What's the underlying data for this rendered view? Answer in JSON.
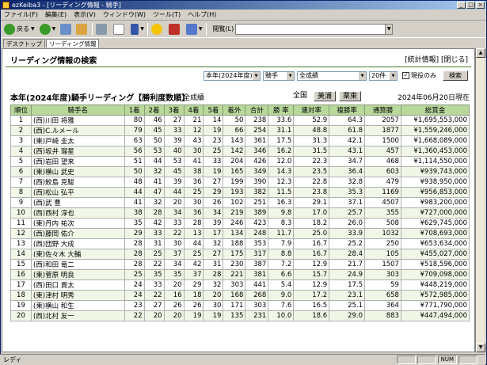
{
  "window": {
    "title": "ezKeiba3 - [リーディング情報 - 騎手]"
  },
  "menu": [
    "ファイル(F)",
    "編集(E)",
    "表示(V)",
    "ウィンドウ(W)",
    "ツール(T)",
    "ヘルプ(H)"
  ],
  "toolbar": {
    "back": "戻る",
    "address_label": "閲覧(L)",
    "address_value": ""
  },
  "tabs": [
    "デスクトップ",
    "リーディング情報"
  ],
  "page": {
    "title": "リーディング情報の検索",
    "links": "[統計情報] [閉じる]",
    "filters": {
      "year": "本年(2024年度)",
      "kind": "騎手",
      "scope": "全成績",
      "count": "20件",
      "checkbox_label": "現役のみ",
      "checked": true,
      "search_button": "検索"
    },
    "heading": "本年(2024年度)騎手リーディング【勝利度数順】",
    "scope_label": "全成績",
    "orgs": [
      "全国",
      "美浦",
      "栗東"
    ],
    "as_of": "2024年06月20日現在"
  },
  "table": {
    "headers": [
      "順位",
      "騎手名",
      "1着",
      "2着",
      "3着",
      "4着",
      "5着",
      "着外",
      "合計",
      "勝 率",
      "連対率",
      "複勝率",
      "通算勝",
      "総賞金"
    ],
    "rows": [
      [
        "1",
        "(西)川田 将雅",
        "80",
        "46",
        "27",
        "21",
        "14",
        "50",
        "238",
        "33.6",
        "52.9",
        "64.3",
        "2057",
        "¥1,695,553,000"
      ],
      [
        "2",
        "(西)C.ルメール",
        "79",
        "45",
        "33",
        "12",
        "19",
        "66",
        "254",
        "31.1",
        "48.8",
        "61.8",
        "1877",
        "¥1,559,246,000"
      ],
      [
        "3",
        "(東)戸崎 圭太",
        "63",
        "50",
        "39",
        "43",
        "23",
        "143",
        "361",
        "17.5",
        "31.3",
        "42.1",
        "1500",
        "¥1,668,089,000"
      ],
      [
        "4",
        "(西)坂井 瑠星",
        "56",
        "53",
        "40",
        "30",
        "25",
        "142",
        "346",
        "16.2",
        "31.5",
        "43.1",
        "457",
        "¥1,360,453,000"
      ],
      [
        "5",
        "(西)岩田 望来",
        "51",
        "44",
        "53",
        "41",
        "33",
        "204",
        "426",
        "12.0",
        "22.3",
        "34.7",
        "468",
        "¥1,114,550,000"
      ],
      [
        "6",
        "(東)横山 武史",
        "50",
        "32",
        "45",
        "38",
        "19",
        "165",
        "349",
        "14.3",
        "23.5",
        "36.4",
        "603",
        "¥939,743,000"
      ],
      [
        "7",
        "(西)鮫島 克駿",
        "48",
        "41",
        "39",
        "36",
        "27",
        "199",
        "390",
        "12.3",
        "22.8",
        "32.8",
        "479",
        "¥938,950,000"
      ],
      [
        "8",
        "(西)松山 弘平",
        "44",
        "47",
        "44",
        "25",
        "29",
        "193",
        "382",
        "11.5",
        "23.8",
        "35.3",
        "1169",
        "¥956,853,000"
      ],
      [
        "9",
        "(西)武 豊",
        "41",
        "32",
        "20",
        "30",
        "26",
        "102",
        "251",
        "16.3",
        "29.1",
        "37.1",
        "4507",
        "¥983,200,000"
      ],
      [
        "10",
        "(西)西村 淳也",
        "38",
        "28",
        "34",
        "36",
        "34",
        "219",
        "389",
        "9.8",
        "17.0",
        "25.7",
        "355",
        "¥727,000,000"
      ],
      [
        "11",
        "(東)丹内 祐次",
        "35",
        "42",
        "33",
        "28",
        "39",
        "246",
        "423",
        "8.3",
        "18.2",
        "26.0",
        "508",
        "¥629,745,000"
      ],
      [
        "12",
        "(西)藤岡 佑介",
        "29",
        "33",
        "22",
        "13",
        "17",
        "134",
        "248",
        "11.7",
        "25.0",
        "33.9",
        "1032",
        "¥708,693,000"
      ],
      [
        "13",
        "(西)団野 大成",
        "28",
        "31",
        "30",
        "44",
        "32",
        "188",
        "353",
        "7.9",
        "16.7",
        "25.2",
        "250",
        "¥653,634,000"
      ],
      [
        "14",
        "(東)佐々木 大輔",
        "28",
        "25",
        "37",
        "25",
        "27",
        "175",
        "317",
        "8.8",
        "16.7",
        "28.4",
        "105",
        "¥455,027,000"
      ],
      [
        "15",
        "(西)和田 竜二",
        "28",
        "22",
        "34",
        "42",
        "31",
        "230",
        "387",
        "7.2",
        "12.9",
        "21.7",
        "1507",
        "¥518,596,000"
      ],
      [
        "16",
        "(東)菅原 明良",
        "25",
        "35",
        "35",
        "37",
        "28",
        "221",
        "381",
        "6.6",
        "15.7",
        "24.9",
        "303",
        "¥709,098,000"
      ],
      [
        "17",
        "(西)田口 貫太",
        "24",
        "33",
        "20",
        "29",
        "32",
        "303",
        "441",
        "5.4",
        "12.9",
        "17.5",
        "59",
        "¥448,219,000"
      ],
      [
        "18",
        "(東)津村 明秀",
        "24",
        "22",
        "16",
        "18",
        "20",
        "168",
        "268",
        "9.0",
        "17.2",
        "23.1",
        "658",
        "¥572,985,000"
      ],
      [
        "19",
        "(東)横山 和生",
        "23",
        "27",
        "26",
        "26",
        "30",
        "171",
        "303",
        "7.6",
        "16.5",
        "25.1",
        "364",
        "¥771,790,000"
      ],
      [
        "20",
        "(西)北村 友一",
        "22",
        "20",
        "20",
        "19",
        "19",
        "135",
        "231",
        "10.0",
        "18.6",
        "29.0",
        "883",
        "¥447,494,000"
      ]
    ]
  },
  "status": {
    "left": "レディ",
    "num": "NUM"
  }
}
